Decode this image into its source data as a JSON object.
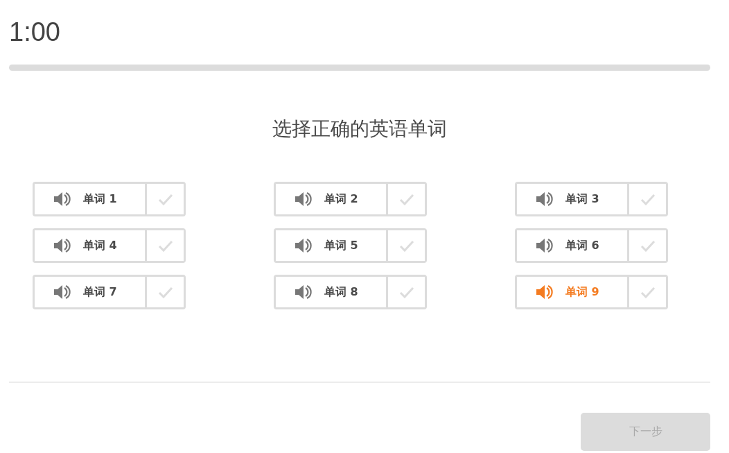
{
  "timer": "1:00",
  "progress": {
    "level": 0
  },
  "title": "选择正确的英语单词",
  "words": [
    {
      "label": "单词 1",
      "playing": false,
      "checked": false
    },
    {
      "label": "单词 2",
      "playing": false,
      "checked": false
    },
    {
      "label": "单词 3",
      "playing": false,
      "checked": false
    },
    {
      "label": "单词 4",
      "playing": false,
      "checked": false
    },
    {
      "label": "单词 5",
      "playing": false,
      "checked": false
    },
    {
      "label": "单词 6",
      "playing": false,
      "checked": false
    },
    {
      "label": "单词 7",
      "playing": false,
      "checked": false
    },
    {
      "label": "单词 8",
      "playing": false,
      "checked": false
    },
    {
      "label": "单词 9",
      "playing": true,
      "checked": false
    }
  ],
  "next_button": {
    "label": "下一步",
    "disabled": true
  }
}
